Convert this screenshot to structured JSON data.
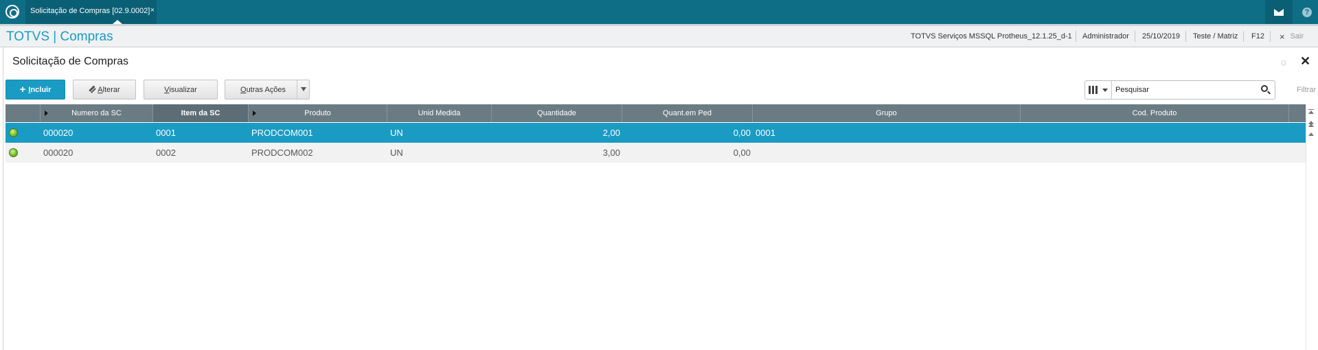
{
  "window": {
    "tab_label": "Solicitação de Compras [02.9.0002]",
    "tab_close": "×",
    "mail_icon": "mail-icon",
    "help_label": "?"
  },
  "header": {
    "brand": "TOTVS | Compras",
    "environment": "TOTVS Serviços MSSQL Protheus_12.1.25_d-1",
    "user": "Administrador",
    "date": "25/10/2019",
    "company": "Teste / Matriz",
    "shortcut": "F12",
    "exit_icon": "×",
    "exit_label": "Sair"
  },
  "page": {
    "title": "Solicitação de Compras",
    "settings_icon": "☼",
    "close_icon": "✕"
  },
  "toolbar": {
    "incluir_plus": "+",
    "incluir_first": "I",
    "incluir_rest": "ncluir",
    "alterar_first": "A",
    "alterar_rest": "lterar",
    "visualizar_first": "V",
    "visualizar_rest": "isualizar",
    "outras_first": "O",
    "outras_rest": "utras Ações"
  },
  "search": {
    "placeholder": "Pesquisar",
    "filter_label": "Filtrar"
  },
  "table": {
    "columns": [
      "",
      "Numero da SC",
      "Item da SC",
      "Produto",
      "Unid Medida",
      "Quantidade",
      "Quant.em Ped",
      "Grupo",
      "Cod. Produto"
    ],
    "rows": [
      {
        "numero": "000020",
        "item": "0001",
        "produto": "PRODCOM001",
        "unid": "UN",
        "quantidade": "2,00",
        "quant_ped": "0,00",
        "grupo": "0001",
        "cod_produto": "",
        "status_color": "#7cc234"
      },
      {
        "numero": "000020",
        "item": "0002",
        "produto": "PRODCOM002",
        "unid": "UN",
        "quantidade": "3,00",
        "quant_ped": "0,00",
        "grupo": "",
        "cod_produto": "",
        "status_color": "#7cc234"
      }
    ]
  },
  "colors": {
    "topbar": "#0e6e86",
    "accent": "#1a9bc4",
    "grid_header": "#6a7b83"
  }
}
